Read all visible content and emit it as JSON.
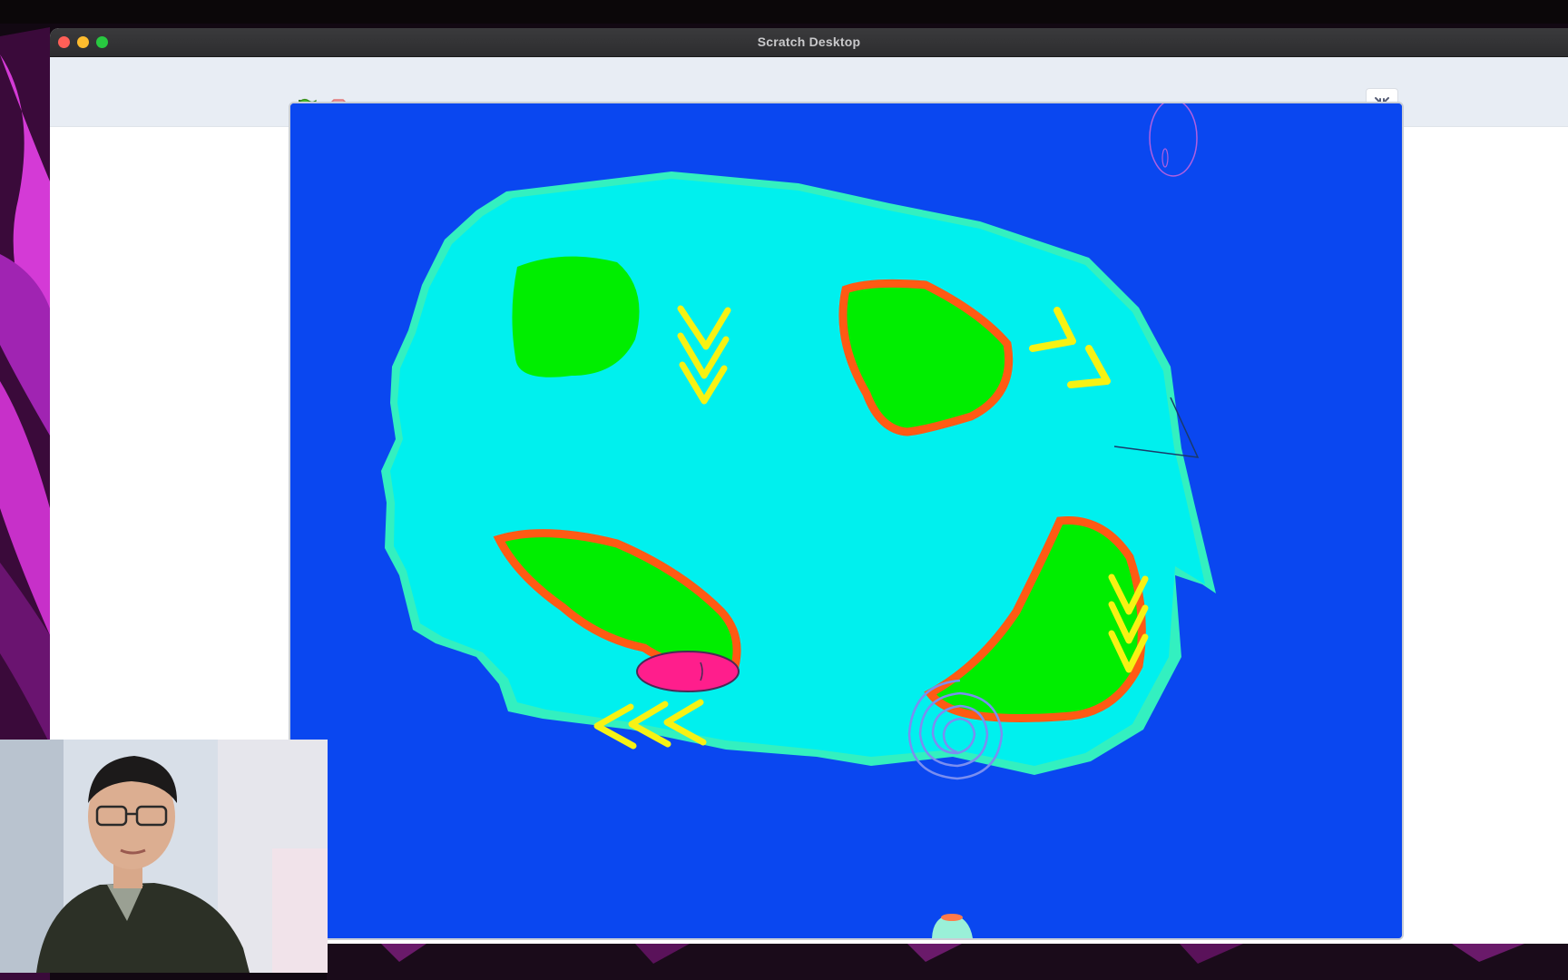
{
  "window": {
    "title": "Scratch Desktop"
  },
  "toolbar": {
    "green_flag_icon": "green-flag-icon",
    "stop_icon": "stop-sign-icon",
    "fullscreen_toggle_icon": "unfullscreen-icon"
  },
  "stage": {
    "background_color": "#0a47f0",
    "island_color": "#00f0ee",
    "grass_color": "#00ee00",
    "outline_color": "#ff5a14",
    "arrow_color": "#f7f213",
    "target_color": "#ff1e8c"
  },
  "colors": {
    "titlebar": "#2d2d2f",
    "toolbar": "#e8edf4"
  }
}
